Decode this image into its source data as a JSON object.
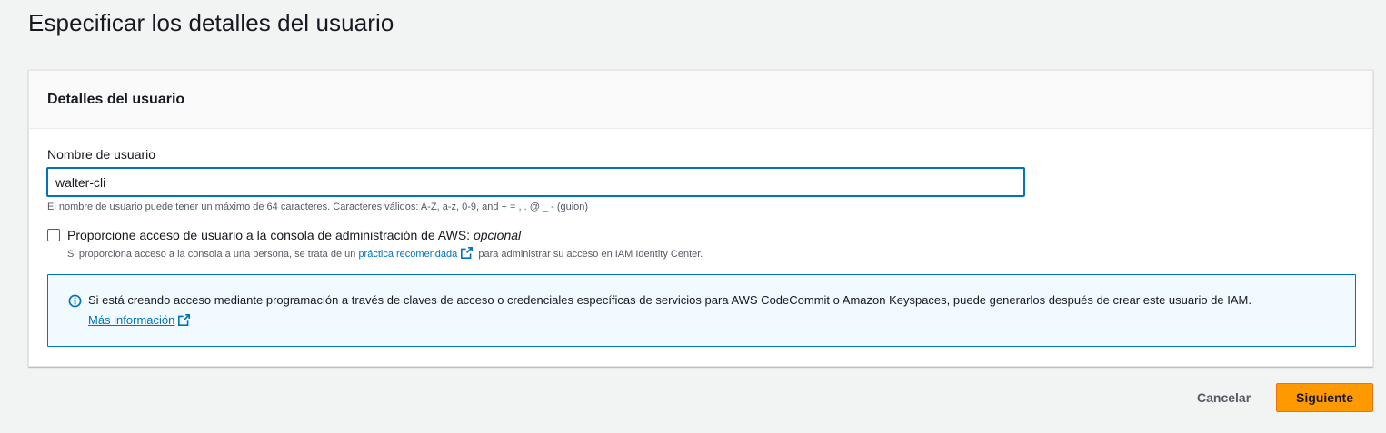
{
  "page": {
    "title": "Especificar los detalles del usuario"
  },
  "panel": {
    "header_title": "Detalles del usuario",
    "username_field": {
      "label": "Nombre de usuario",
      "value": "walter-cli",
      "hint": "El nombre de usuario puede tener un máximo de 64 caracteres. Caracteres válidos: A-Z, a-z, 0-9, and + = , . @ _ - (guion)"
    },
    "console_access": {
      "checked": false,
      "label": "Proporcione acceso de usuario a la consola de administración de AWS:",
      "label_optional": "opcional",
      "desc_prefix": "Si proporciona acceso a la consola a una persona, se trata de un",
      "desc_link": "práctica recomendada",
      "desc_suffix": "para administrar su acceso en IAM Identity Center."
    },
    "info_alert": {
      "text": "Si está creando acceso mediante programación a través de claves de acceso o credenciales específicas de servicios para AWS CodeCommit o Amazon Keyspaces, puede generarlos después de crear este usuario de IAM.",
      "link": "Más información"
    }
  },
  "actions": {
    "cancel_label": "Cancelar",
    "next_label": "Siguiente"
  },
  "colors": {
    "accent_link": "#0073bb",
    "primary_button": "#ff9900",
    "info_background": "#f1faff"
  },
  "icons": {
    "external_link": "external-link-icon",
    "info": "info-icon"
  }
}
